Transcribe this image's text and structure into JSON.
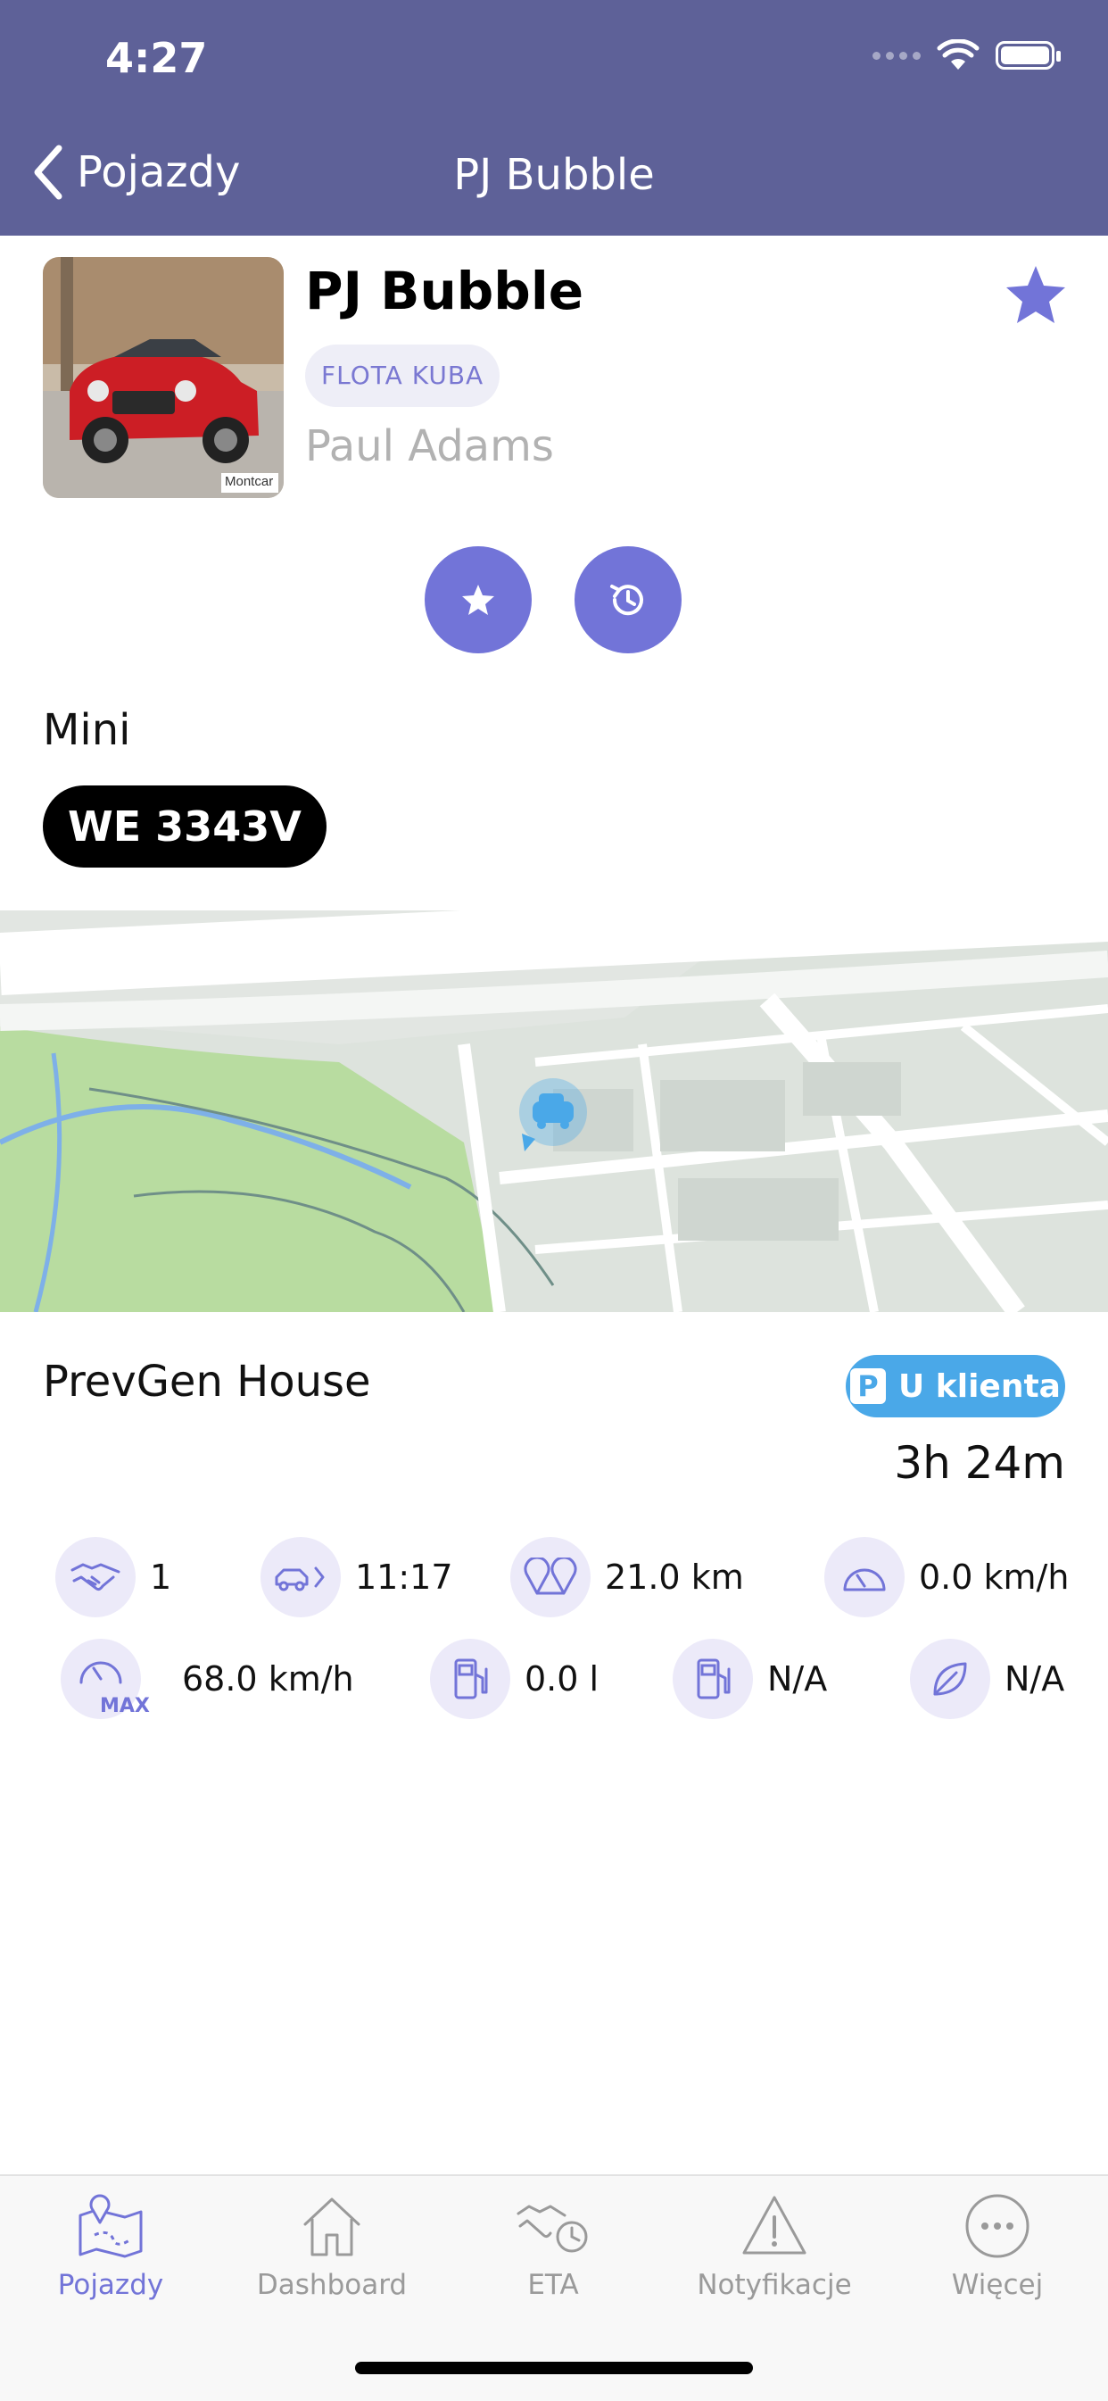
{
  "status_bar": {
    "time": "4:27"
  },
  "nav": {
    "back_label": "Pojazdy",
    "title": "PJ Bubble"
  },
  "vehicle": {
    "name": "PJ Bubble",
    "fleet": "FLOTA KUBA",
    "driver": "Paul Adams",
    "brand": "Mini",
    "plate": "WE 3343V",
    "thumb_watermark": "Montcar"
  },
  "location": {
    "name": "PrevGen House",
    "status": "U klienta",
    "status_letter": "P",
    "duration": "3h 24m"
  },
  "stats": {
    "trips": "1",
    "trip_time": "11:17",
    "distance": "21.0 km",
    "speed": "0.0 km/h",
    "max_speed": "68.0 km/h",
    "max_label": "MAX",
    "fuel": "0.0 l",
    "fuel_level": "N/A",
    "eco": "N/A"
  },
  "tabs": [
    {
      "label": "Pojazdy",
      "icon": "map-pin-icon",
      "active": true
    },
    {
      "label": "Dashboard",
      "icon": "home-icon",
      "active": false
    },
    {
      "label": "ETA",
      "icon": "handshake-clock-icon",
      "active": false
    },
    {
      "label": "Notyfikacje",
      "icon": "warning-icon",
      "active": false
    },
    {
      "label": "Więcej",
      "icon": "more-icon",
      "active": false
    }
  ],
  "colors": {
    "header": "#5e6198",
    "accent": "#7274d8",
    "status_badge": "#4aa8e8",
    "fleet_tag_bg": "#eeeef7"
  }
}
